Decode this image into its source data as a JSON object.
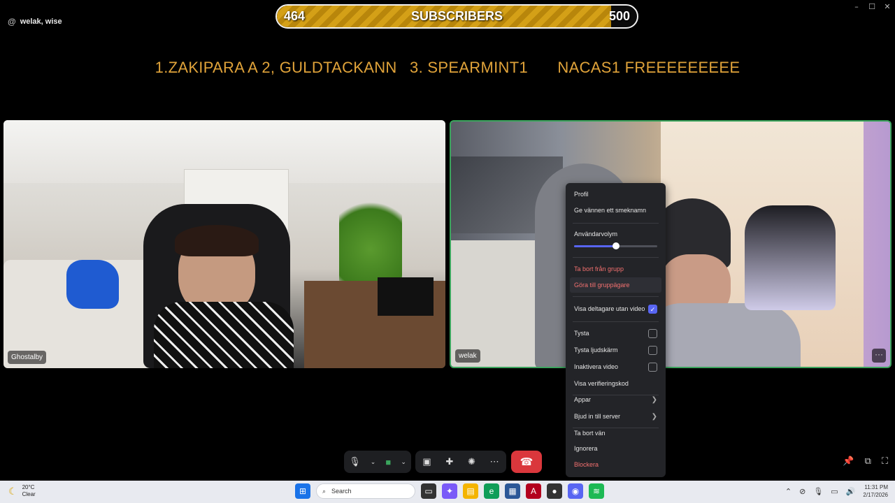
{
  "window": {
    "channel_name": "welak, wise",
    "controls": [
      "–",
      "☐",
      "✕"
    ]
  },
  "subscriber_bar": {
    "current": "464",
    "label": "SUBSCRIBERS",
    "goal": "500",
    "progress": 0.928
  },
  "ticker": {
    "items": [
      "1.ZAKIPARA A 2, GULDTACKANN",
      "3. SPEARMINT1",
      "NACAS1 FREEEEEEEEE"
    ]
  },
  "tiles": [
    {
      "name": "Ghostalby"
    },
    {
      "name": "welak",
      "more": "···"
    }
  ],
  "context_menu": {
    "profile": "Profil",
    "nickname": "Ge vännen ett smeknamn",
    "user_volume": "Användarvolym",
    "volume_level": 0.5,
    "remove_from_group": "Ta bort från grupp",
    "make_owner": "Göra till gruppägare",
    "show_no_video": "Visa deltagare utan video",
    "show_no_video_checked": true,
    "mute": "Tysta",
    "mute_soundboard": "Tysta ljudskärm",
    "disable_video": "Inaktivera video",
    "verification": "Visa verifieringskod",
    "apps": "Appar",
    "invite_server": "Bjud in till server",
    "remove_friend": "Ta bort vän",
    "ignore": "Ignorera",
    "block": "Blockera"
  },
  "taskbar": {
    "weather_temp": "20°C",
    "weather_cond": "Clear",
    "search_placeholder": "Search",
    "time": "11:31 PM",
    "date": "2/17/2026"
  }
}
